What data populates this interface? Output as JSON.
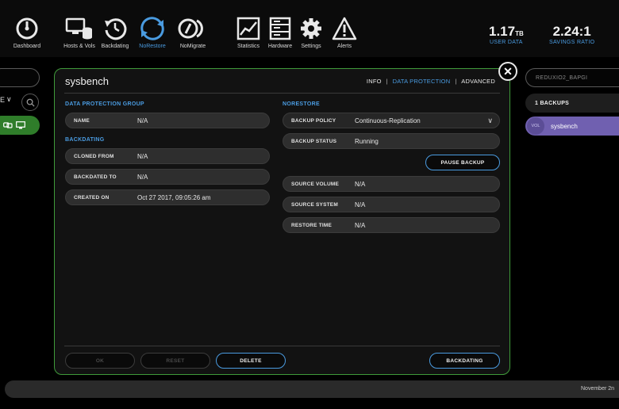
{
  "toolbar": {
    "items": [
      {
        "label": "Dashboard",
        "icon": "dashboard-icon"
      },
      {
        "label": "Hosts & Vols",
        "icon": "hosts-volumes-icon"
      },
      {
        "label": "Backdating",
        "icon": "backdating-icon"
      },
      {
        "label": "NoRestore",
        "icon": "norestore-icon",
        "active": true
      },
      {
        "label": "NoMigrate",
        "icon": "nomigrate-icon"
      },
      {
        "label": "Statistics",
        "icon": "statistics-icon"
      },
      {
        "label": "Hardware",
        "icon": "hardware-icon"
      },
      {
        "label": "Settings",
        "icon": "settings-icon"
      },
      {
        "label": "Alerts",
        "icon": "alerts-icon"
      }
    ],
    "stats": {
      "user_data_value": "1.17",
      "user_data_unit": "TB",
      "user_data_label": "USER DATA",
      "savings_value": "2.24:1",
      "savings_label": "SAVINGS RATIO"
    }
  },
  "left": {
    "select_partial": "E"
  },
  "dialog": {
    "title": "sysbench",
    "tabs": [
      "INFO",
      "DATA PROTECTION",
      "ADVANCED"
    ],
    "active_tab": "DATA PROTECTION",
    "left_col": {
      "group_heading": "DATA PROTECTION GROUP",
      "name_label": "NAME",
      "name_value": "N/A",
      "backdating_heading": "BACKDATING",
      "cloned_from_label": "CLONED FROM",
      "cloned_from_value": "N/A",
      "backdated_to_label": "BACKDATED TO",
      "backdated_to_value": "N/A",
      "created_on_label": "CREATED ON",
      "created_on_value": "Oct 27 2017, 09:05:26 am"
    },
    "right_col": {
      "heading": "NORESTORE",
      "backup_policy_label": "BACKUP POLICY",
      "backup_policy_value": "Continuous-Replication",
      "backup_status_label": "BACKUP STATUS",
      "backup_status_value": "Running",
      "pause_backup_label": "PAUSE BACKUP",
      "source_volume_label": "SOURCE VOLUME",
      "source_volume_value": "N/A",
      "source_system_label": "SOURCE SYSTEM",
      "source_system_value": "N/A",
      "restore_time_label": "RESTORE TIME",
      "restore_time_value": "N/A"
    },
    "footer": {
      "ok_label": "OK",
      "reset_label": "RESET",
      "delete_label": "DELETE",
      "backdating_label": "BACKDATING"
    }
  },
  "right_panel": {
    "search_text": "REDUXIO2_BAPGI",
    "count_label": "1 BACKUPS",
    "item_badge": "VOL",
    "item_name": "sysbench"
  },
  "status_bar": {
    "date": "November 2n"
  },
  "colors": {
    "accent_blue": "#4a9be0",
    "dialog_border_green": "#3f9a3a",
    "selected_purple": "#7060b0",
    "active_green": "#2f7d2a"
  }
}
